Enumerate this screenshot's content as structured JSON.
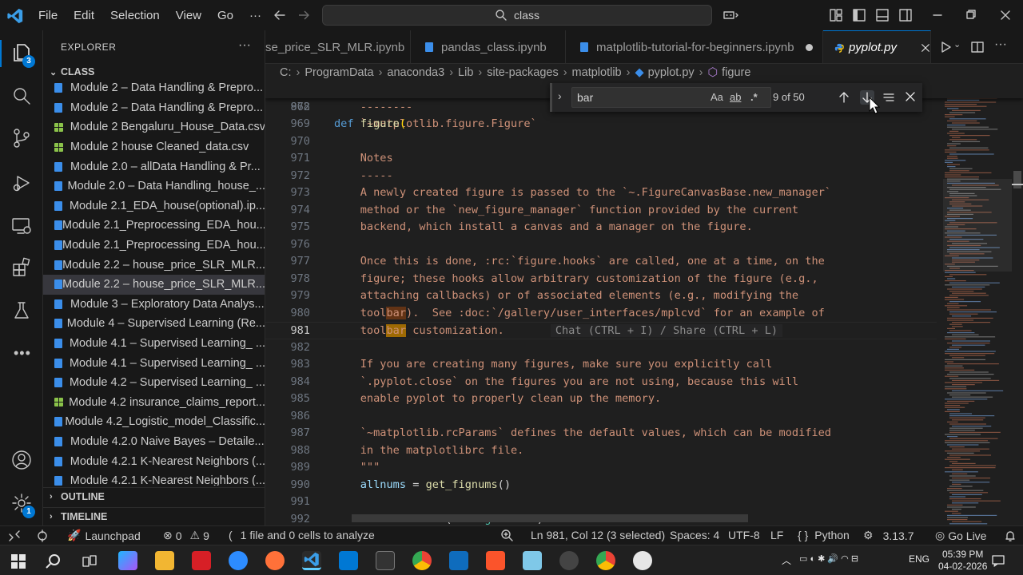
{
  "titlebar": {
    "menu": [
      "File",
      "Edit",
      "Selection",
      "View",
      "Go"
    ],
    "more": "···",
    "search": "class"
  },
  "activity": {
    "explorer_badge": "3",
    "settings_badge": "1"
  },
  "sidebar": {
    "title": "EXPLORER",
    "more": "···",
    "folder": "CLASS",
    "files": [
      {
        "name": "Module 2 – Data Handling & Prepro...",
        "kind": "notebook"
      },
      {
        "name": "Module 2 – Data Handling & Prepro...",
        "kind": "notebook"
      },
      {
        "name": "Module 2 Bengaluru_House_Data.csv",
        "kind": "csv"
      },
      {
        "name": "Module 2 house Cleaned_data.csv",
        "kind": "csv"
      },
      {
        "name": "Module 2.0 – allData Handling & Pr...",
        "kind": "notebook"
      },
      {
        "name": "Module 2.0 – Data Handling_house_...",
        "kind": "notebook"
      },
      {
        "name": "Module 2.1_EDA_house(optional).ip...",
        "kind": "notebook"
      },
      {
        "name": "Module 2.1_Preprocessing_EDA_hou...",
        "kind": "notebook"
      },
      {
        "name": "Module 2.1_Preprocessing_EDA_hou...",
        "kind": "notebook"
      },
      {
        "name": "Module 2.2 – house_price_SLR_MLR...",
        "kind": "notebook"
      },
      {
        "name": "Module 2.2 – house_price_SLR_MLR...",
        "kind": "notebook",
        "selected": true
      },
      {
        "name": "Module 3 – Exploratory Data Analys...",
        "kind": "notebook"
      },
      {
        "name": "Module 4 – Supervised Learning (Re...",
        "kind": "notebook"
      },
      {
        "name": "Module 4.1 – Supervised Learning_ ...",
        "kind": "notebook"
      },
      {
        "name": "Module 4.1 – Supervised Learning_ ...",
        "kind": "notebook"
      },
      {
        "name": "Module 4.2 – Supervised Learning_ ...",
        "kind": "notebook"
      },
      {
        "name": "Module 4.2 insurance_claims_report...",
        "kind": "csv"
      },
      {
        "name": "Module 4.2_Logistic_model_Classific...",
        "kind": "notebook"
      },
      {
        "name": "Module 4.2.0  Naive Bayes – Detaile...",
        "kind": "notebook"
      },
      {
        "name": "Module 4.2.1 K-Nearest Neighbors (...",
        "kind": "notebook"
      },
      {
        "name": "Module 4.2.1 K-Nearest Neighbors (...",
        "kind": "notebook"
      }
    ],
    "outline": "OUTLINE",
    "timeline": "TIMELINE"
  },
  "tabs": [
    {
      "label": "se_price_SLR_MLR.ipynb",
      "dirty": true
    },
    {
      "label": "pandas_class.ipynb",
      "dirty": false
    },
    {
      "label": "matplotlib-tutorial-for-beginners.ipynb",
      "dirty": true
    },
    {
      "label": "pyplot.py",
      "active": true
    }
  ],
  "breadcrumb": [
    "C:",
    "ProgramData",
    "anaconda3",
    "Lib",
    "site-packages",
    "matplotlib",
    "pyplot.py",
    "figure"
  ],
  "find": {
    "query": "bar",
    "match_case": "Aa",
    "whole_word": "ab",
    "regex": ".*",
    "count": "9 of 50"
  },
  "editor": {
    "sticky": {
      "num": "872",
      "kw": "def",
      "fn": "figure",
      "rest": "("
    },
    "lines": [
      {
        "n": "968",
        "t": "    --------"
      },
      {
        "n": "969",
        "t": "    `~matplotlib.figure.Figure`"
      },
      {
        "n": "970",
        "t": ""
      },
      {
        "n": "971",
        "t": "    Notes"
      },
      {
        "n": "972",
        "t": "    -----"
      },
      {
        "n": "973",
        "t": "    A newly created figure is passed to the `~.FigureCanvasBase.new_manager`"
      },
      {
        "n": "974",
        "t": "    method or the `new_figure_manager` function provided by the current"
      },
      {
        "n": "975",
        "t": "    backend, which install a canvas and a manager on the figure."
      },
      {
        "n": "976",
        "t": ""
      },
      {
        "n": "977",
        "t": "    Once this is done, :rc:`figure.hooks` are called, one at a time, on the"
      },
      {
        "n": "978",
        "t": "    figure; these hooks allow arbitrary customization of the figure (e.g.,"
      },
      {
        "n": "979",
        "t": "    attaching callbacks) or of associated elements (e.g., modifying the"
      },
      {
        "n": "980",
        "a": "    tool",
        "h": "bar",
        "b": ").  See :doc:`/gallery/user_interfaces/mplcvd` for an example of"
      },
      {
        "n": "981",
        "a": "    tool",
        "h": "bar",
        "b": " customization.",
        "ghost": "Chat (CTRL + I) / Share (CTRL + L)",
        "current": true
      },
      {
        "n": "982",
        "t": ""
      },
      {
        "n": "983",
        "t": "    If you are creating many figures, make sure you explicitly call"
      },
      {
        "n": "984",
        "t": "    `.pyplot.close` on the figures you are not using, because this will"
      },
      {
        "n": "985",
        "t": "    enable pyplot to properly clean up the memory."
      },
      {
        "n": "986",
        "t": ""
      },
      {
        "n": "987",
        "t": "    `~matplotlib.rcParams` defines the default values, which can be modified"
      },
      {
        "n": "988",
        "t": "    in the matplotlibrc file."
      },
      {
        "n": "989",
        "t": "    \"\"\""
      },
      {
        "n": "990",
        "code": "allnums"
      },
      {
        "n": "991",
        "t": ""
      },
      {
        "n": "992",
        "code": "isinstance"
      }
    ],
    "l990": {
      "a": "allnums",
      "b": " = ",
      "c": "get_fignums",
      "d": "()"
    },
    "l992": {
      "a": "if ",
      "b": "isinstance",
      "c": "(",
      "d": "num",
      ".": ", ",
      "e": "FigureBase",
      "f": "):"
    }
  },
  "status": {
    "launchpad": "Launchpad",
    "errors": "0",
    "warnings": "9",
    "analyze": "1 file and 0 cells to analyze",
    "position": "Ln 981, Col 12 (3 selected)",
    "spaces": "Spaces: 4",
    "encoding": "UTF-8",
    "eol": "LF",
    "language": "Python",
    "version": "3.13.7",
    "golive": "Go Live"
  },
  "taskbar": {
    "lang": "ENG",
    "time": "05:39 PM",
    "date": "04-02-2026"
  },
  "colors": {
    "accent": "#0078d4",
    "match": "#623315",
    "current_match": "#9e6a03"
  }
}
